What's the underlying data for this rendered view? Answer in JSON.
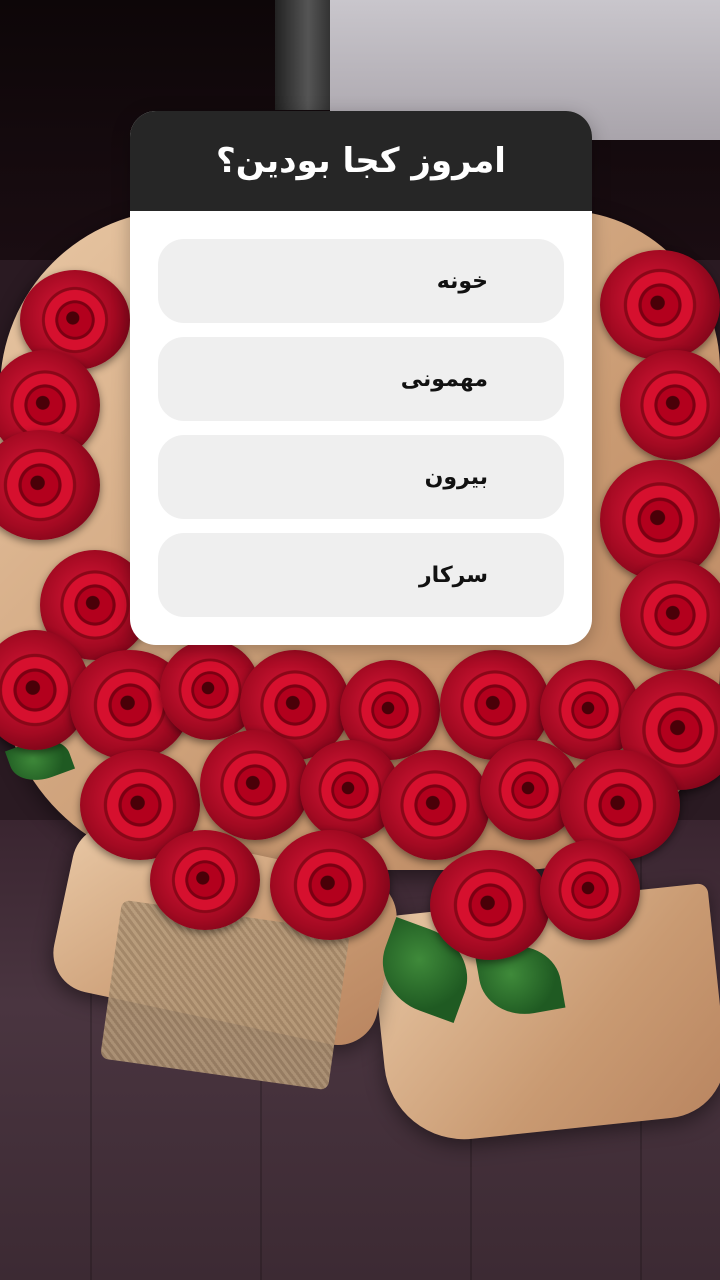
{
  "story_background": {
    "description_icon": "rose-bouquet-photo"
  },
  "poll": {
    "question": "امروز کجا بودین؟",
    "options": [
      {
        "label": "خونه"
      },
      {
        "label": "مهمونی"
      },
      {
        "label": "بیرون"
      },
      {
        "label": "سرکار"
      }
    ]
  },
  "colors": {
    "header_bg": "#262626",
    "option_bg": "#efefef",
    "rose_red": "#c8102e"
  }
}
